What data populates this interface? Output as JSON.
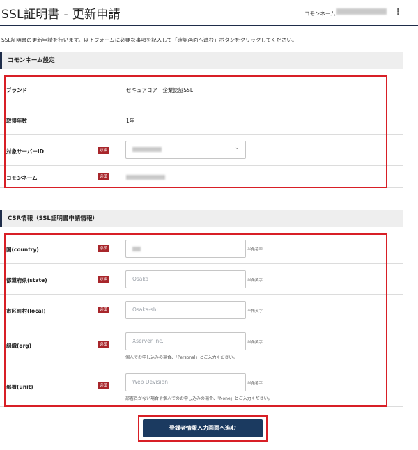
{
  "header": {
    "title": "SSL証明書 - 更新申請",
    "common_name_label": "コモンネーム",
    "menu_icon": "more-vertical-icon"
  },
  "intro": "SSL証明書の更新申請を行います。以下フォームに必要な事項を記入して「確認画面へ進む」ボタンをクリックしてください。",
  "section1": {
    "title": "コモンネーム設定",
    "rows": {
      "brand": {
        "label": "ブランド",
        "value": "セキュアコア　企業認証SSL"
      },
      "years": {
        "label": "取得年数",
        "value": "1年"
      },
      "server": {
        "label": "対象サーバーID",
        "required": "必須"
      },
      "common_name": {
        "label": "コモンネーム",
        "required": "必須"
      }
    }
  },
  "section2": {
    "title": "CSR情報（SSL証明書申請情報）",
    "rows": {
      "country": {
        "label": "国(country)",
        "required": "必須",
        "hint": "半角英字"
      },
      "state": {
        "label": "都道府県(state)",
        "required": "必須",
        "placeholder": "Osaka",
        "hint": "半角英字"
      },
      "local": {
        "label": "市区町村(local)",
        "required": "必須",
        "placeholder": "Osaka-shi",
        "hint": "半角英字"
      },
      "org": {
        "label": "組織(org)",
        "required": "必須",
        "placeholder": "Xserver Inc.",
        "hint": "半角英字",
        "note": "個人でお申し込みの場合、「Personal」とご入力ください。"
      },
      "unit": {
        "label": "部署(unit)",
        "required": "必須",
        "placeholder": "Web Devision",
        "hint": "半角英字",
        "note": "部署名がない場合や個人でのお申し込みの場合、「None」とご入力ください。"
      }
    }
  },
  "submit_label": "登録者情報入力画面へ進む",
  "colors": {
    "accent": "#1f2d4a",
    "button": "#1b3a60",
    "required_badge": "#a8262b",
    "highlight_border": "#d81f26"
  }
}
